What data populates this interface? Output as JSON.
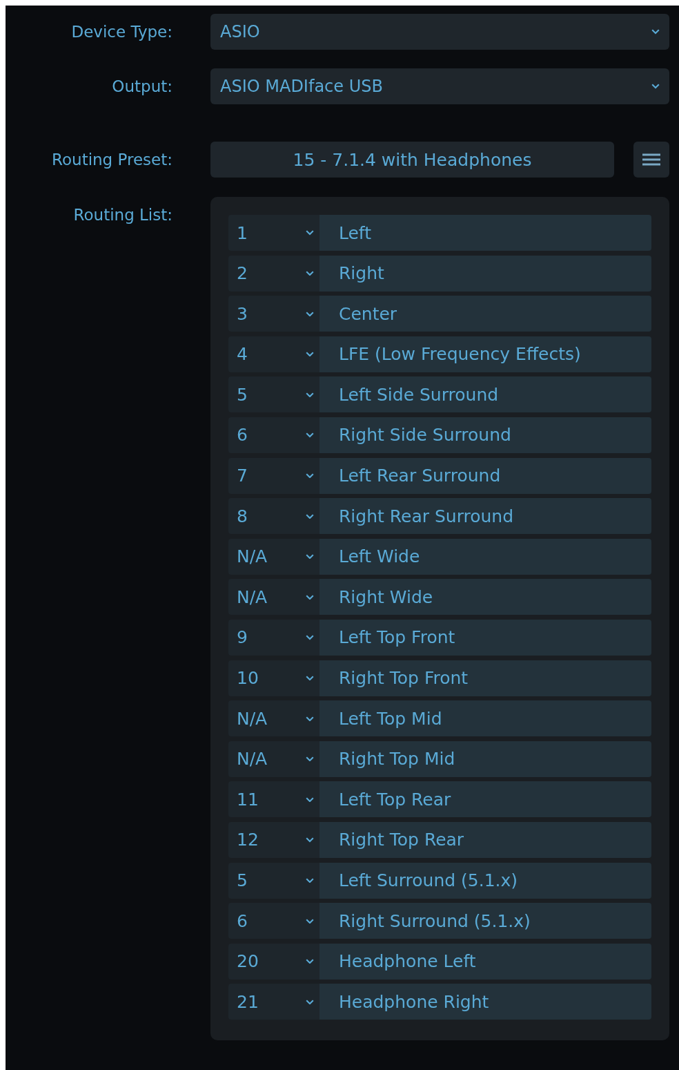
{
  "device_type": {
    "label": "Device Type:",
    "value": "ASIO"
  },
  "output": {
    "label": "Output:",
    "value": "ASIO MADIface USB"
  },
  "routing_preset": {
    "label": "Routing Preset:",
    "value": "15 - 7.1.4 with Headphones"
  },
  "routing_list": {
    "label": "Routing List:",
    "rows": [
      {
        "channel": "1",
        "name": "Left"
      },
      {
        "channel": "2",
        "name": "Right"
      },
      {
        "channel": "3",
        "name": "Center"
      },
      {
        "channel": "4",
        "name": "LFE (Low Frequency Effects)"
      },
      {
        "channel": "5",
        "name": "Left Side Surround"
      },
      {
        "channel": "6",
        "name": "Right Side Surround"
      },
      {
        "channel": "7",
        "name": "Left Rear Surround"
      },
      {
        "channel": "8",
        "name": "Right Rear Surround"
      },
      {
        "channel": "N/A",
        "name": "Left Wide"
      },
      {
        "channel": "N/A",
        "name": "Right Wide"
      },
      {
        "channel": "9",
        "name": "Left Top Front"
      },
      {
        "channel": "10",
        "name": "Right Top Front"
      },
      {
        "channel": "N/A",
        "name": "Left Top Mid"
      },
      {
        "channel": "N/A",
        "name": "Right Top Mid"
      },
      {
        "channel": "11",
        "name": "Left Top Rear"
      },
      {
        "channel": "12",
        "name": "Right Top Rear"
      },
      {
        "channel": "5",
        "name": "Left Surround (5.1.x)"
      },
      {
        "channel": "6",
        "name": "Right Surround (5.1.x)"
      },
      {
        "channel": "20",
        "name": "Headphone Left"
      },
      {
        "channel": "21",
        "name": "Headphone Right"
      }
    ]
  }
}
